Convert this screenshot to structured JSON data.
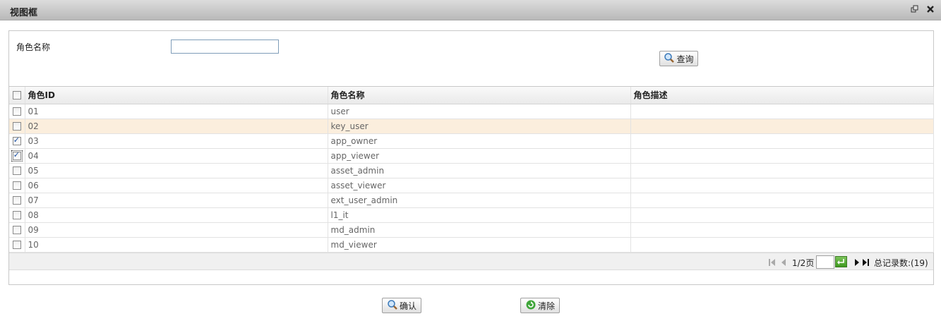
{
  "window": {
    "title": "视图框"
  },
  "search": {
    "label": "角色名称",
    "value": "",
    "query_label": "查询"
  },
  "grid": {
    "headers": [
      "角色ID",
      "角色名称",
      "角色描述"
    ],
    "rows": [
      {
        "id": "01",
        "name": "user",
        "desc": "",
        "checked": false
      },
      {
        "id": "02",
        "name": "key_user",
        "desc": "",
        "checked": false
      },
      {
        "id": "03",
        "name": "app_owner",
        "desc": "",
        "checked": true
      },
      {
        "id": "04",
        "name": "app_viewer",
        "desc": "",
        "checked": true
      },
      {
        "id": "05",
        "name": "asset_admin",
        "desc": "",
        "checked": false
      },
      {
        "id": "06",
        "name": "asset_viewer",
        "desc": "",
        "checked": false
      },
      {
        "id": "07",
        "name": "ext_user_admin",
        "desc": "",
        "checked": false
      },
      {
        "id": "08",
        "name": "l1_it",
        "desc": "",
        "checked": false
      },
      {
        "id": "09",
        "name": "md_admin",
        "desc": "",
        "checked": false
      },
      {
        "id": "10",
        "name": "md_viewer",
        "desc": "",
        "checked": false
      }
    ],
    "highlighted_row": 1
  },
  "pager": {
    "page_info": "1/2页",
    "page_input": "",
    "total": "总记录数:(19)"
  },
  "footer": {
    "confirm_label": "确认",
    "clear_label": "清除"
  },
  "icons": {
    "restore": "restore-icon",
    "close": "close-icon",
    "search": "magnifier-icon",
    "refresh": "refresh-icon"
  },
  "colors": {
    "highlight_row": "#fbeedd",
    "go_button": "#4caa2a"
  }
}
